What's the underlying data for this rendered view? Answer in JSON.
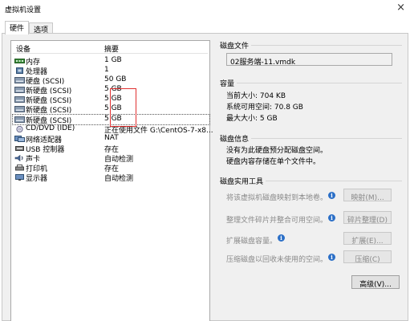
{
  "window": {
    "title": "虚拟机设置",
    "close_glyph": "×"
  },
  "tabs": [
    {
      "label": "硬件",
      "active": true
    },
    {
      "label": "选项",
      "active": false
    }
  ],
  "device_list": {
    "headers": {
      "device": "设备",
      "summary": "摘要"
    },
    "rows": [
      {
        "name": "内存",
        "summary": "1 GB",
        "icon": "memory-icon"
      },
      {
        "name": "处理器",
        "summary": "1",
        "icon": "processor-icon"
      },
      {
        "name": "硬盘 (SCSI)",
        "summary": "50 GB",
        "icon": "hard-disk-icon"
      },
      {
        "name": "新硬盘 (SCSI)",
        "summary": "5 GB",
        "icon": "hard-disk-icon"
      },
      {
        "name": "新硬盘 (SCSI)",
        "summary": "5 GB",
        "icon": "hard-disk-icon"
      },
      {
        "name": "新硬盘 (SCSI)",
        "summary": "5 GB",
        "icon": "hard-disk-icon"
      },
      {
        "name": "新硬盘 (SCSI)",
        "summary": "5 GB",
        "icon": "hard-disk-icon",
        "selected": true
      },
      {
        "name": "CD/DVD (IDE)",
        "summary": "正在使用文件 G:\\CentOS-7-x8...",
        "icon": "cd-dvd-icon"
      },
      {
        "name": "网络适配器",
        "summary": "NAT",
        "icon": "network-adapter-icon"
      },
      {
        "name": "USB 控制器",
        "summary": "存在",
        "icon": "usb-icon"
      },
      {
        "name": "声卡",
        "summary": "自动检测",
        "icon": "sound-card-icon"
      },
      {
        "name": "打印机",
        "summary": "存在",
        "icon": "printer-icon"
      },
      {
        "name": "显示器",
        "summary": "自动检测",
        "icon": "display-icon"
      }
    ]
  },
  "disk_file": {
    "title": "磁盘文件",
    "path": "02服务端-11.vmdk"
  },
  "capacity": {
    "title": "容量",
    "current_size": "当前大小: 704 KB",
    "system_free": "系统可用空间: 70.8 GB",
    "max_size": "最大大小: 5 GB"
  },
  "disk_info": {
    "title": "磁盘信息",
    "line1": "没有为此硬盘预分配磁盘空间。",
    "line2": "硬盘内容存储在单个文件中。"
  },
  "utilities": {
    "title": "磁盘实用工具",
    "rows": [
      {
        "label": "将该虚拟机磁盘映射到本地卷。",
        "button": "映射(M)..."
      },
      {
        "label": "整理文件碎片并整合可用空间。",
        "button": "碎片整理(D)"
      },
      {
        "label": "扩展磁盘容量。",
        "button": "扩展(E)..."
      },
      {
        "label": "压缩磁盘以回收未使用的空间。",
        "button": "压缩(C)"
      }
    ]
  },
  "advanced_button": "高级(V)...",
  "colors": {
    "highlight_box": "#e03030",
    "info_icon": "#2b6fc7"
  }
}
